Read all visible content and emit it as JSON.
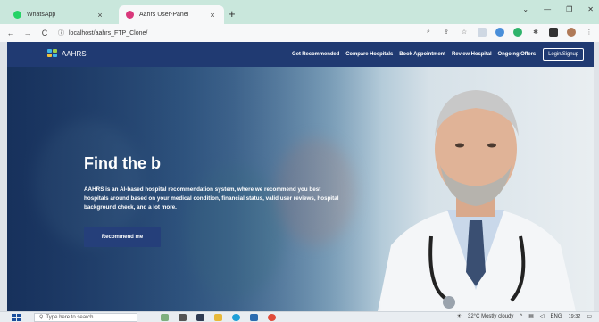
{
  "browser": {
    "tabs": [
      {
        "title": "WhatsApp",
        "active": false
      },
      {
        "title": "Aahrs User-Panel",
        "active": true
      }
    ],
    "new_tab_symbol": "+",
    "url": "localhost/aahrs_FTP_Clone/"
  },
  "site": {
    "logo_text": "AAHRS",
    "nav": [
      "Get Recommended",
      "Compare Hospitals",
      "Book Appointment",
      "Review Hospital",
      "Ongoing Offers"
    ],
    "login_label": "Login/Signup"
  },
  "hero": {
    "title": "Find the b",
    "description": "AAHRS is an AI-based hospital recommendation system, where we recommend you best hospitals around based on your medical condition, financial status, valid user reviews, hospital background check, and a lot more.",
    "cta_label": "Recommend me"
  },
  "taskbar": {
    "search_placeholder": "Type here to search",
    "weather": "32°C  Mostly cloudy",
    "language": "ENG",
    "time": "19:32"
  },
  "colors": {
    "nav_bg": "#203a72",
    "cta_bg": "#253f7a",
    "tab_strip": "#c9e7dc"
  }
}
